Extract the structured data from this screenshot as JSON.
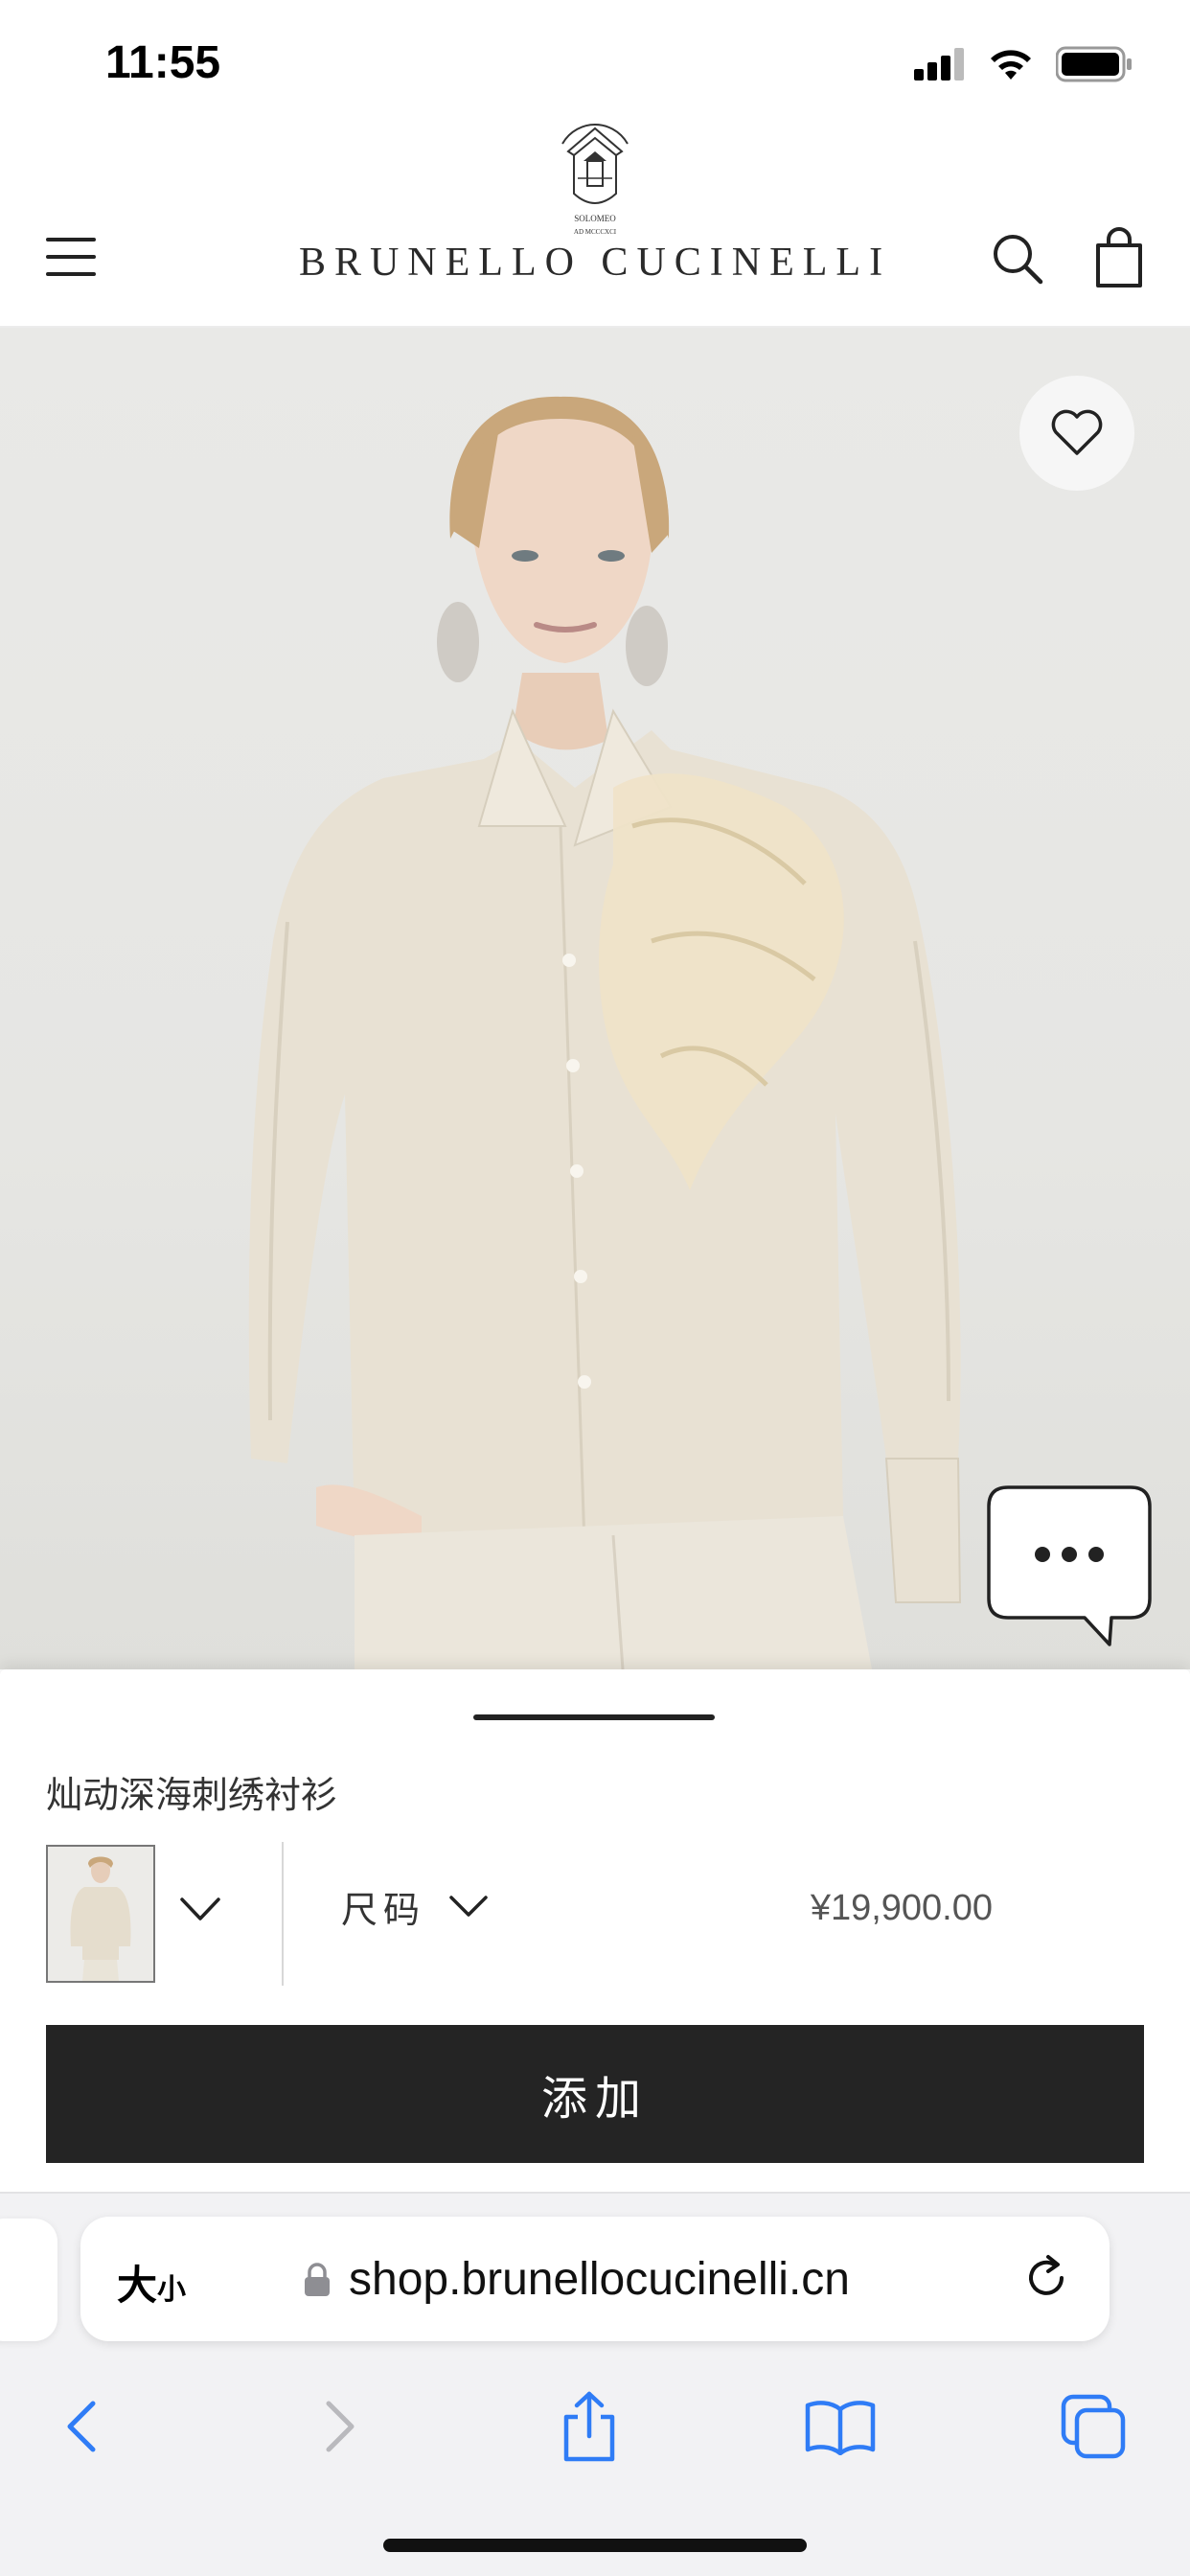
{
  "status_bar": {
    "time": "11:55"
  },
  "header": {
    "brand_name": "BRUNELLO CUCINELLI",
    "logo_text": "SOLOMEO",
    "logo_subtext": "AD MCCCXCI"
  },
  "product": {
    "title": "灿动深海刺绣衬衫",
    "size_label": "尺码",
    "price": "¥19,900.00",
    "add_button_label": "添加"
  },
  "browser": {
    "text_size_label_big": "大",
    "text_size_label_small": "小",
    "url": "shop.brunellocucinelli.cn"
  },
  "icons": {
    "menu": "hamburger-icon",
    "search": "search-icon",
    "bag": "shopping-bag-icon",
    "wishlist": "heart-icon",
    "chat": "chat-bubble-icon",
    "lock": "lock-icon",
    "reload": "reload-icon",
    "back": "chevron-left-icon",
    "forward": "chevron-right-icon",
    "share": "share-icon",
    "bookmarks": "book-icon",
    "tabs": "tabs-icon"
  },
  "colors": {
    "brand_dark": "#242424",
    "safari_blue": "#2f7cf6",
    "image_bg": "#e8e8e6",
    "garment": "#e8e1d3"
  }
}
